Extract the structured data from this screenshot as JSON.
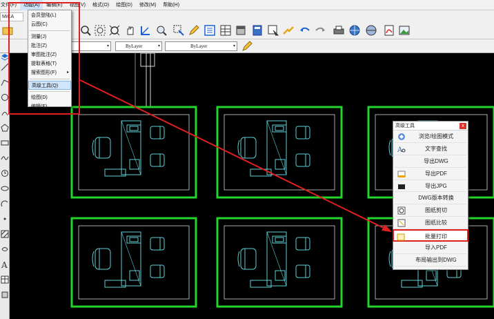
{
  "menubar": {
    "items": [
      {
        "label": "文件(F)"
      },
      {
        "label": "功能(A)"
      },
      {
        "label": "编辑(E)"
      },
      {
        "label": "视图(V)"
      },
      {
        "label": "格式(O)"
      },
      {
        "label": "绘图(D)"
      },
      {
        "label": "修改(M)"
      },
      {
        "label": "帮助(H)"
      }
    ]
  },
  "toolbar": {
    "tab_label": "MiCA"
  },
  "properties": {
    "color_combo": "ByLayer",
    "linetype_combo": "ByLayer"
  },
  "function_menu": {
    "items": [
      {
        "label": "会员登陆(L)"
      },
      {
        "label": "云图(C)"
      },
      {
        "label": "测量(J)"
      },
      {
        "label": "批注(Z)"
      },
      {
        "label": "审图批注(Z)"
      },
      {
        "label": "提取表格(T)"
      },
      {
        "label": "搜索图形(F)",
        "submenu": "▸"
      },
      {
        "label": "高级工具(Q)"
      },
      {
        "label": "绘图(D)"
      },
      {
        "label": "编辑(E)"
      }
    ]
  },
  "tool_panel": {
    "title": "高级工具",
    "close": "x",
    "items": [
      {
        "label": "浏览/绘图模式",
        "icon": "browse-mode-icon"
      },
      {
        "label": "文字查找",
        "icon": "text-search-icon"
      },
      {
        "label": "导出DWG",
        "icon": "export-dwg-icon"
      },
      {
        "label": "导出PDF",
        "icon": "export-pdf-icon"
      },
      {
        "label": "导出JPG",
        "icon": "export-jpg-icon"
      },
      {
        "label": "DWG版本转换",
        "icon": "version-convert-icon"
      },
      {
        "label": "图纸剪切",
        "icon": "drawing-clip-icon"
      },
      {
        "label": "图纸比较",
        "icon": "drawing-compare-icon"
      },
      {
        "label": "批量打印",
        "icon": "batch-print-icon"
      },
      {
        "label": "导入PDF",
        "icon": "import-pdf-icon"
      },
      {
        "label": "布局输出到DWG",
        "icon": "layout-export-icon"
      }
    ]
  },
  "colors": {
    "highlight_red": "#e02020",
    "room_green": "#22d42b",
    "furniture_cyan": "#5fd0d8"
  }
}
